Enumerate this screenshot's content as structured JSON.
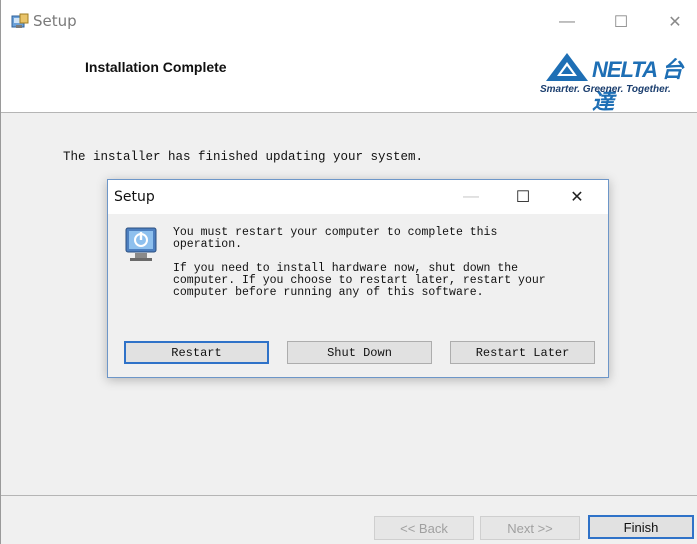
{
  "window": {
    "title": "Setup",
    "icon": "setup-icon",
    "controls": {
      "minimize": "—",
      "maximize": "☐",
      "close": "✕"
    }
  },
  "header": {
    "title": "Installation Complete",
    "logo": {
      "wordmark": "NELTA 台達",
      "tagline": "Smarter. Greener. Together.",
      "color": "#1e6fb5"
    }
  },
  "body": {
    "message": "The installer has finished updating your system."
  },
  "footer": {
    "back_label": "<< Back",
    "next_label": "Next >>",
    "finish_label": "Finish"
  },
  "dialog": {
    "title": "Setup",
    "icon": "power-icon",
    "controls": {
      "minimize": "—",
      "maximize": "☐",
      "close": "✕"
    },
    "message_line1": "You must restart your computer to complete this",
    "message_line2": "operation.",
    "message_line3": "If you need to install hardware now, shut down the",
    "message_line4": "computer. If you choose to restart later, restart your",
    "message_line5": "computer before running any of this software.",
    "buttons": {
      "restart": "Restart",
      "shut_down": "Shut Down",
      "restart_later": "Restart Later"
    }
  },
  "colors": {
    "accent": "#2f72c8",
    "dialog_border": "#6d96c8",
    "background": "#f0f0f0"
  }
}
